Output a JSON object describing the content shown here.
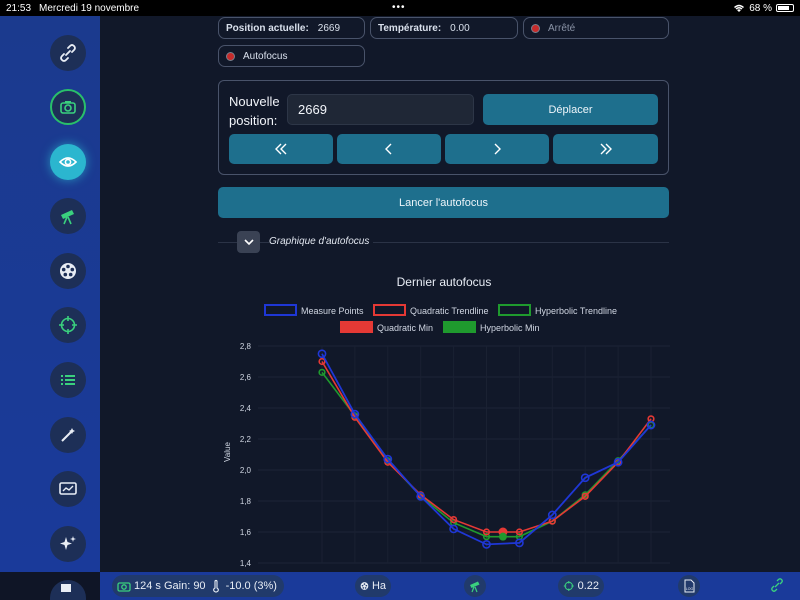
{
  "statusbar": {
    "time": "21:53",
    "date": "Mercredi 19 novembre",
    "dots": "•••",
    "battery": "68 %"
  },
  "sidebar": {
    "items": [
      "link-icon",
      "camera-icon",
      "eye-icon",
      "telescope-icon",
      "filter-wheel-icon",
      "guider-icon",
      "sequence-list-icon",
      "magic-wand-icon",
      "monitor-icon",
      "sparkles-icon",
      "truck-icon"
    ]
  },
  "status": {
    "position_label": "Position actuelle:",
    "position_value": "2669",
    "temperature_label": "Température:",
    "temperature_value": "0.00",
    "state": "Arrêté",
    "autofocus": "Autofocus"
  },
  "move": {
    "label": "Nouvelle position:",
    "value": "2669",
    "move_button": "Déplacer"
  },
  "autofocus_button": "Lancer l'autofocus",
  "graph_toggle_label": "Graphique d'autofocus",
  "colors": {
    "measure": "#1f37d6",
    "quadratic": "#e53935",
    "hyperbolic": "#1f9a2e",
    "accent": "#1e6f8d"
  },
  "chart_data": {
    "type": "line",
    "title": "Dernier autofocus",
    "ylabel": "Value",
    "xlabel": "",
    "ylim": [
      1.4,
      2.8
    ],
    "yticks": [
      "2,8",
      "2,6",
      "2,4",
      "2,2",
      "2,0",
      "1,8",
      "1,6",
      "1,4"
    ],
    "legend": [
      "Measure Points",
      "Quadratic Trendline",
      "Hyperbolic Trendline",
      "Quadratic Min",
      "Hyperbolic Min"
    ],
    "series": [
      {
        "name": "Measure Points",
        "values": [
          2.75,
          2.36,
          2.07,
          1.83,
          1.62,
          1.52,
          1.53,
          1.71,
          1.95,
          2.05,
          2.29
        ]
      },
      {
        "name": "Quadratic Trendline",
        "values": [
          2.7,
          2.34,
          2.05,
          1.84,
          1.68,
          1.6,
          1.6,
          1.67,
          1.83,
          2.05,
          2.33
        ]
      },
      {
        "name": "Hyperbolic Trendline",
        "values": [
          2.63,
          2.35,
          2.06,
          1.83,
          1.66,
          1.57,
          1.57,
          1.67,
          1.84,
          2.06,
          2.29
        ]
      }
    ],
    "quadratic_min": [
      5.5,
      1.6
    ],
    "hyperbolic_min": [
      5.5,
      1.57
    ]
  },
  "bottombar": {
    "camera": "124 s Gain: 90",
    "temperature": "-10.0 (3%)",
    "filter": "Ha",
    "guide": "0.22",
    "log": "LOG"
  }
}
